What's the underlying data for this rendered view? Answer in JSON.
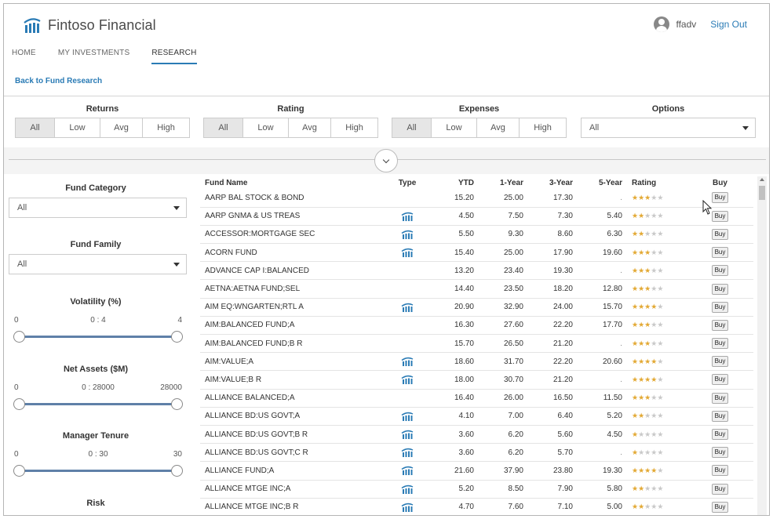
{
  "brand": {
    "name": "Fintoso Financial"
  },
  "user": {
    "name": "ffadv",
    "signout": "Sign Out"
  },
  "nav": [
    {
      "label": "HOME"
    },
    {
      "label": "MY INVESTMENTS"
    },
    {
      "label": "RESEARCH",
      "active": true
    }
  ],
  "back_link": "Back to Fund Research",
  "filters": {
    "returns": {
      "title": "Returns",
      "options": [
        "All",
        "Low",
        "Avg",
        "High"
      ],
      "selected": "All"
    },
    "rating": {
      "title": "Rating",
      "options": [
        "All",
        "Low",
        "Avg",
        "High"
      ],
      "selected": "All"
    },
    "expenses": {
      "title": "Expenses",
      "options": [
        "All",
        "Low",
        "Avg",
        "High"
      ],
      "selected": "All"
    },
    "options": {
      "title": "Options",
      "value": "All"
    }
  },
  "sidebar": {
    "fund_category": {
      "title": "Fund Category",
      "value": "All"
    },
    "fund_family": {
      "title": "Fund Family",
      "value": "All"
    },
    "volatility": {
      "title": "Volatility (%)",
      "min": "0",
      "range": "0 : 4",
      "max": "4"
    },
    "net_assets": {
      "title": "Net Assets ($M)",
      "min": "0",
      "range": "0 : 28000",
      "max": "28000"
    },
    "manager_tenure": {
      "title": "Manager Tenure",
      "min": "0",
      "range": "0 : 30",
      "max": "30"
    },
    "risk": {
      "title": "Risk"
    }
  },
  "table": {
    "headers": {
      "name": "Fund Name",
      "type": "Type",
      "ytd": "YTD",
      "y1": "1-Year",
      "y3": "3-Year",
      "y5": "5-Year",
      "rating": "Rating",
      "buy": "Buy"
    },
    "buy_label": "Buy",
    "star_color": "#e3a934",
    "rows": [
      {
        "name": "AARP BAL STOCK & BOND",
        "type_icon": false,
        "ytd": "15.20",
        "y1": "25.00",
        "y3": "17.30",
        "y5": ".",
        "stars": 3
      },
      {
        "name": "AARP GNMA & US TREAS",
        "type_icon": true,
        "ytd": "4.50",
        "y1": "7.50",
        "y3": "7.30",
        "y5": "5.40",
        "stars": 2
      },
      {
        "name": "ACCESSOR:MORTGAGE SEC",
        "type_icon": true,
        "ytd": "5.50",
        "y1": "9.30",
        "y3": "8.60",
        "y5": "6.30",
        "stars": 2
      },
      {
        "name": "ACORN FUND",
        "type_icon": true,
        "ytd": "15.40",
        "y1": "25.00",
        "y3": "17.90",
        "y5": "19.60",
        "stars": 3
      },
      {
        "name": "ADVANCE CAP I:BALANCED",
        "type_icon": false,
        "ytd": "13.20",
        "y1": "23.40",
        "y3": "19.30",
        "y5": ".",
        "stars": 3
      },
      {
        "name": "AETNA:AETNA FUND;SEL",
        "type_icon": false,
        "ytd": "14.40",
        "y1": "23.50",
        "y3": "18.20",
        "y5": "12.80",
        "stars": 3
      },
      {
        "name": "AIM EQ:WNGARTEN;RTL A",
        "type_icon": true,
        "ytd": "20.90",
        "y1": "32.90",
        "y3": "24.00",
        "y5": "15.70",
        "stars": 4
      },
      {
        "name": "AIM:BALANCED FUND;A",
        "type_icon": false,
        "ytd": "16.30",
        "y1": "27.60",
        "y3": "22.20",
        "y5": "17.70",
        "stars": 3
      },
      {
        "name": "AIM:BALANCED FUND;B R",
        "type_icon": false,
        "ytd": "15.70",
        "y1": "26.50",
        "y3": "21.20",
        "y5": ".",
        "stars": 3
      },
      {
        "name": "AIM:VALUE;A",
        "type_icon": true,
        "ytd": "18.60",
        "y1": "31.70",
        "y3": "22.20",
        "y5": "20.60",
        "stars": 4
      },
      {
        "name": "AIM:VALUE;B R",
        "type_icon": true,
        "ytd": "18.00",
        "y1": "30.70",
        "y3": "21.20",
        "y5": ".",
        "stars": 4
      },
      {
        "name": "ALLIANCE BALANCED;A",
        "type_icon": false,
        "ytd": "16.40",
        "y1": "26.00",
        "y3": "16.50",
        "y5": "11.50",
        "stars": 3
      },
      {
        "name": "ALLIANCE BD:US GOVT;A",
        "type_icon": true,
        "ytd": "4.10",
        "y1": "7.00",
        "y3": "6.40",
        "y5": "5.20",
        "stars": 2
      },
      {
        "name": "ALLIANCE BD:US GOVT;B R",
        "type_icon": true,
        "ytd": "3.60",
        "y1": "6.20",
        "y3": "5.60",
        "y5": "4.50",
        "stars": 1
      },
      {
        "name": "ALLIANCE BD:US GOVT;C R",
        "type_icon": true,
        "ytd": "3.60",
        "y1": "6.20",
        "y3": "5.70",
        "y5": ".",
        "stars": 1
      },
      {
        "name": "ALLIANCE FUND;A",
        "type_icon": true,
        "ytd": "21.60",
        "y1": "37.90",
        "y3": "23.80",
        "y5": "19.30",
        "stars": 4
      },
      {
        "name": "ALLIANCE MTGE INC;A",
        "type_icon": true,
        "ytd": "5.20",
        "y1": "8.50",
        "y3": "7.90",
        "y5": "5.80",
        "stars": 2
      },
      {
        "name": "ALLIANCE MTGE INC;B R",
        "type_icon": true,
        "ytd": "4.70",
        "y1": "7.60",
        "y3": "7.10",
        "y5": "5.00",
        "stars": 2
      }
    ]
  }
}
